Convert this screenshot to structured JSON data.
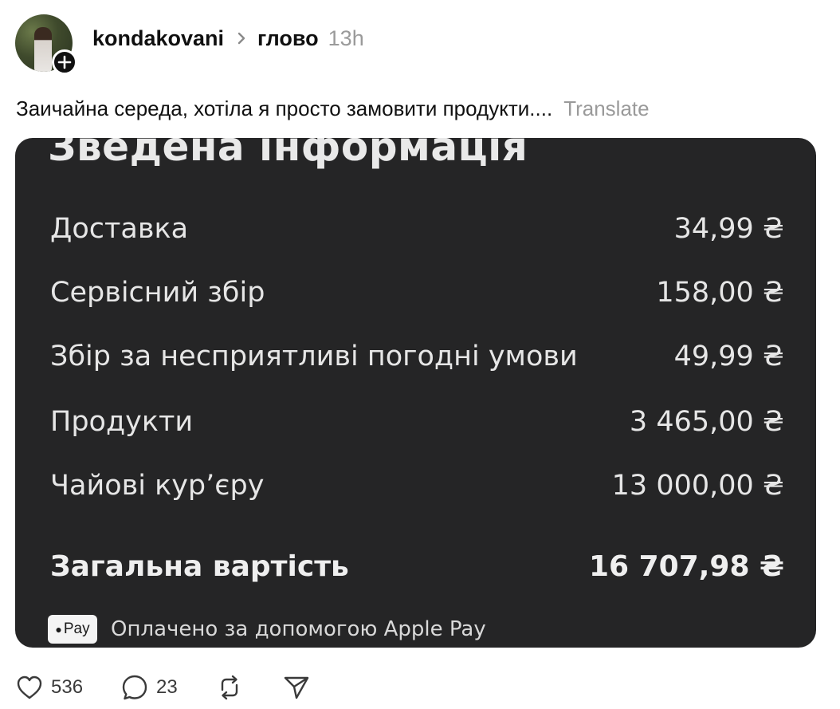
{
  "post": {
    "author": {
      "username": "kondakovani",
      "avatar_icon": "avatar",
      "follow_icon": "plus-icon"
    },
    "topic": "глово",
    "timestamp": "13h",
    "text": "Заичайна середа, хотіла я просто замовити продукти....",
    "translate_label": "Translate"
  },
  "receipt": {
    "title": "Зведена інформація",
    "rows": [
      {
        "label": "Доставка",
        "value": "34,99 ₴"
      },
      {
        "label": "Сервісний збір",
        "value": "158,00 ₴"
      },
      {
        "label": "Збір за несприятливі погодні умови",
        "value": "49,99 ₴"
      },
      {
        "label": "Продукти",
        "value": "3 465,00 ₴"
      },
      {
        "label": "Чайові кур’єру",
        "value": "13 000,00 ₴"
      }
    ],
    "total": {
      "label": "Загальна вартість",
      "value": "16 707,98 ₴"
    },
    "payment_badge": "Pay",
    "payment_note": "Оплачено за допомогою Apple Pay",
    "background_color": "#252526"
  },
  "actions": {
    "likes": "536",
    "comments": "23",
    "like_icon": "heart-icon",
    "comment_icon": "comment-icon",
    "repost_icon": "repost-icon",
    "share_icon": "send-icon"
  }
}
